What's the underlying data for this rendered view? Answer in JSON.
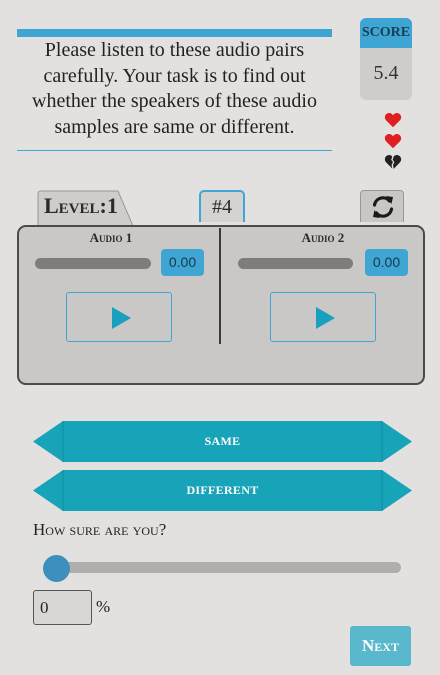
{
  "instructions": "Please listen to these audio pairs carefully. Your task is to find out whether the speakers of these audio samples are same or different.",
  "score": {
    "label": "SCORE",
    "value": "5.4"
  },
  "lives": [
    "full",
    "full",
    "broken"
  ],
  "level": {
    "label": "Level:1"
  },
  "pair_number": "#4",
  "audio": [
    {
      "label": "Audio 1",
      "time": "0.00"
    },
    {
      "label": "Audio 2",
      "time": "0.00"
    }
  ],
  "answers": {
    "same": "SAME",
    "different": "DIFFERENT"
  },
  "confidence": {
    "label": "How sure are you?",
    "value": "0",
    "unit": "%"
  },
  "next_label": "Next",
  "colors": {
    "accent": "#3fa5d3",
    "answer": "#17a3b8",
    "heart": "#e02020"
  }
}
